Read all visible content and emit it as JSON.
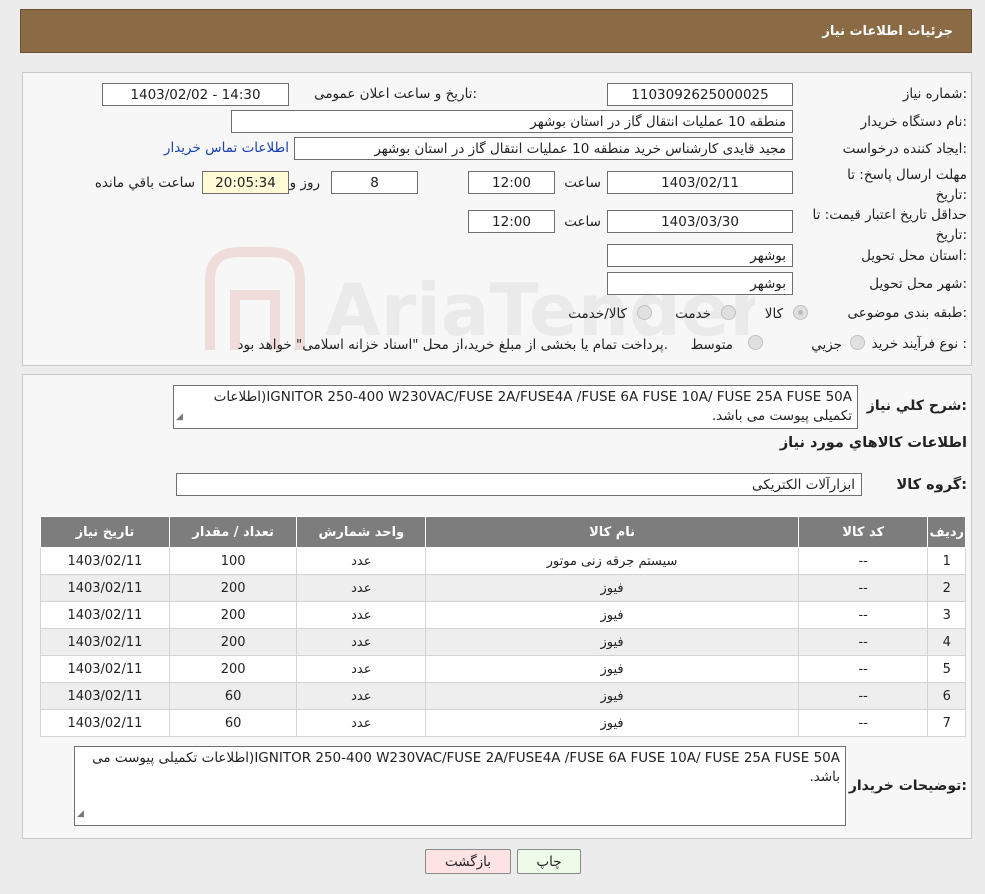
{
  "header": {
    "title": "جزئیات اطلاعات نیاز"
  },
  "fields": {
    "need_number_label": "شماره نیاز:",
    "need_number": "1103092625000025",
    "announce_label": "تاریخ و ساعت اعلان عمومی:",
    "announce_value": "1403/02/02 - 14:30",
    "buyer_org_label": "نام دستگاه خریدار:",
    "buyer_org": "منطقه 10 عملیات انتقال گاز در استان بوشهر",
    "creator_label": "ایجاد کننده درخواست:",
    "creator": "مجید قایدی کارشناس خرید منطقه 10 عملیات انتقال گاز در استان بوشهر",
    "contact_link": "اطلاعات تماس خریدار",
    "deadline_label_1": "مهلت ارسال پاسخ: تا",
    "deadline_label_2": "تاریخ:",
    "deadline_date": "1403/02/11",
    "time_label": "ساعت",
    "deadline_time": "12:00",
    "days_value": "8",
    "days_label": "روز و",
    "remaining_time": "20:05:34",
    "remaining_label": "ساعت باقي مانده",
    "validity_label_1": "حداقل تاریخ اعتبار قیمت: تا",
    "validity_label_2": "تاریخ:",
    "validity_date": "1403/03/30",
    "validity_time": "12:00",
    "province_label": "استان محل تحویل:",
    "province": "بوشهر",
    "city_label": "شهر محل تحویل:",
    "city": "بوشهر",
    "category_label": "طبقه بندی موضوعی:",
    "category_options": [
      "کالا",
      "خدمت",
      "کالا/خدمت"
    ],
    "process_label": "نوع فرآیند خرید :",
    "process_options": [
      "جزيي",
      "متوسط"
    ],
    "process_note": "پرداخت تمام یا بخشی از مبلغ خرید،از محل \"اسناد خزانه اسلامی\" خواهد بود."
  },
  "summary": {
    "label": "شرح کلي نياز:",
    "text": "IGNITOR 250-400 W230VAC/FUSE 2A/FUSE4A /FUSE  6A  FUSE 10A/ FUSE  25A FUSE  50A(اطلاعات تکمیلی پیوست می باشد."
  },
  "goods": {
    "section_title": "اطلاعات کالاهاي مورد نياز",
    "group_label": "گروه کالا:",
    "group_value": "ابزارآلات الکتریکی",
    "columns": [
      "رديف",
      "کد کالا",
      "نام کالا",
      "واحد شمارش",
      "تعداد / مقدار",
      "تاریخ نیاز"
    ],
    "rows": [
      [
        "1",
        "--",
        "سیستم جرقه زنی موتور",
        "عدد",
        "100",
        "1403/02/11"
      ],
      [
        "2",
        "--",
        "فیوز",
        "عدد",
        "200",
        "1403/02/11"
      ],
      [
        "3",
        "--",
        "فیوز",
        "عدد",
        "200",
        "1403/02/11"
      ],
      [
        "4",
        "--",
        "فیوز",
        "عدد",
        "200",
        "1403/02/11"
      ],
      [
        "5",
        "--",
        "فیوز",
        "عدد",
        "200",
        "1403/02/11"
      ],
      [
        "6",
        "--",
        "فیوز",
        "عدد",
        "60",
        "1403/02/11"
      ],
      [
        "7",
        "--",
        "فیوز",
        "عدد",
        "60",
        "1403/02/11"
      ]
    ]
  },
  "buyer_notes": {
    "label": "توضیحات خریدار:",
    "text": "IGNITOR 250-400 W230VAC/FUSE 2A/FUSE4A /FUSE  6A  FUSE 10A/ FUSE  25A FUSE  50A(اطلاعات تکمیلی پیوست می باشد."
  },
  "buttons": {
    "print": "چاپ",
    "back": "بازگشت"
  },
  "watermark": {
    "text": "AriaTender.neT"
  },
  "colors": {
    "header": "#8b6b45",
    "table_header": "#7d7d7d",
    "link": "#1a3fb0",
    "watermark": "#c0392b"
  }
}
